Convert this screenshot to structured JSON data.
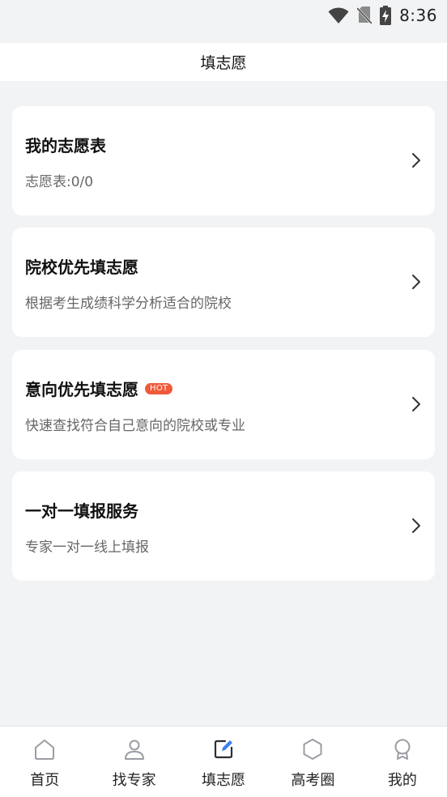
{
  "status_bar": {
    "time": "8:36",
    "icons": [
      "wifi-icon",
      "no-sim-icon",
      "battery-charging-icon"
    ]
  },
  "nav": {
    "title": "填志愿"
  },
  "cards": [
    {
      "title": "我的志愿表",
      "subtitle": "志愿表:0/0",
      "badge": ""
    },
    {
      "title": "院校优先填志愿",
      "subtitle": "根据考生成绩科学分析适合的院校",
      "badge": ""
    },
    {
      "title": "意向优先填志愿",
      "subtitle": "快速查找符合自己意向的院校或专业",
      "badge": "HOT"
    },
    {
      "title": "一对一填报服务",
      "subtitle": "专家一对一线上填报",
      "badge": ""
    }
  ],
  "tabs": [
    {
      "label": "首页",
      "icon": "home-icon"
    },
    {
      "label": "找专家",
      "icon": "person-icon"
    },
    {
      "label": "填志愿",
      "icon": "edit-icon",
      "active": true
    },
    {
      "label": "高考圈",
      "icon": "hexagon-icon"
    },
    {
      "label": "我的",
      "icon": "medal-icon"
    }
  ],
  "colors": {
    "background": "#f2f3f5",
    "card": "#ffffff",
    "hot_badge": "#ef5a3a",
    "active_tab_accent": "#3d7ff0",
    "icon_inactive": "#9a9da3"
  }
}
